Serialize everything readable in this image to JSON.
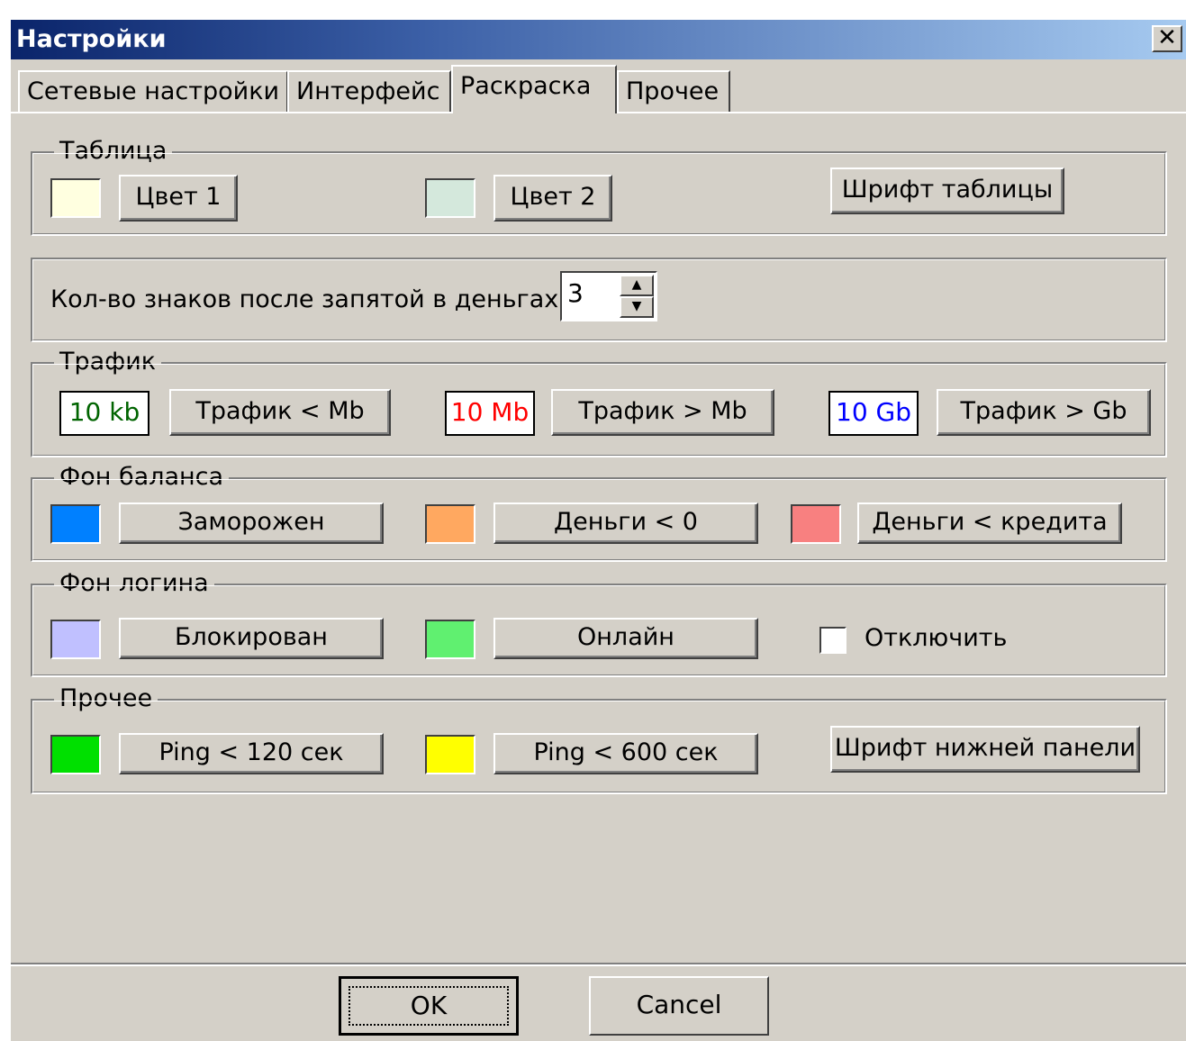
{
  "window": {
    "title": "Настройки",
    "close_glyph": "✕"
  },
  "tabs": [
    {
      "label": "Сетевые настройки"
    },
    {
      "label": "Интерфейс"
    },
    {
      "label": "Раскраска"
    },
    {
      "label": "Прочее"
    }
  ],
  "table_group": {
    "legend": "Таблица",
    "color1": {
      "label": "Цвет 1",
      "swatch": "#ffffe0"
    },
    "color2": {
      "label": "Цвет 2",
      "swatch": "#d4e8dc"
    },
    "font_label": "Шрифт таблицы"
  },
  "decimals": {
    "label": "Кол-во знаков после запятой в деньгах.",
    "value": "3"
  },
  "traffic_group": {
    "legend": "Трафик",
    "items": [
      {
        "sample": "10 kb",
        "sample_color": "#006400",
        "label": "Трафик < Mb"
      },
      {
        "sample": "10 Mb",
        "sample_color": "#ff0000",
        "label": "Трафик > Mb"
      },
      {
        "sample": "10 Gb",
        "sample_color": "#0000ff",
        "label": "Трафик > Gb"
      }
    ]
  },
  "balance_group": {
    "legend": "Фон баланса",
    "items": [
      {
        "label": "Заморожен",
        "swatch": "#0080ff"
      },
      {
        "label": "Деньги < 0",
        "swatch": "#ffa860"
      },
      {
        "label": "Деньги < кредита",
        "swatch": "#f88080"
      }
    ]
  },
  "login_group": {
    "legend": "Фон логина",
    "items": [
      {
        "label": "Блокирован",
        "swatch": "#c0c0ff"
      },
      {
        "label": "Онлайн",
        "swatch": "#60f070"
      }
    ],
    "disable_label": "Отключить",
    "disable_checked": false
  },
  "other_group": {
    "legend": "Прочее",
    "items": [
      {
        "label": "Ping < 120 сек",
        "swatch": "#00e000"
      },
      {
        "label": "Ping < 600 сек",
        "swatch": "#ffff00"
      }
    ],
    "font_label": "Шрифт нижней панели"
  },
  "footer": {
    "ok_label": "OK",
    "cancel_label": "Cancel"
  }
}
